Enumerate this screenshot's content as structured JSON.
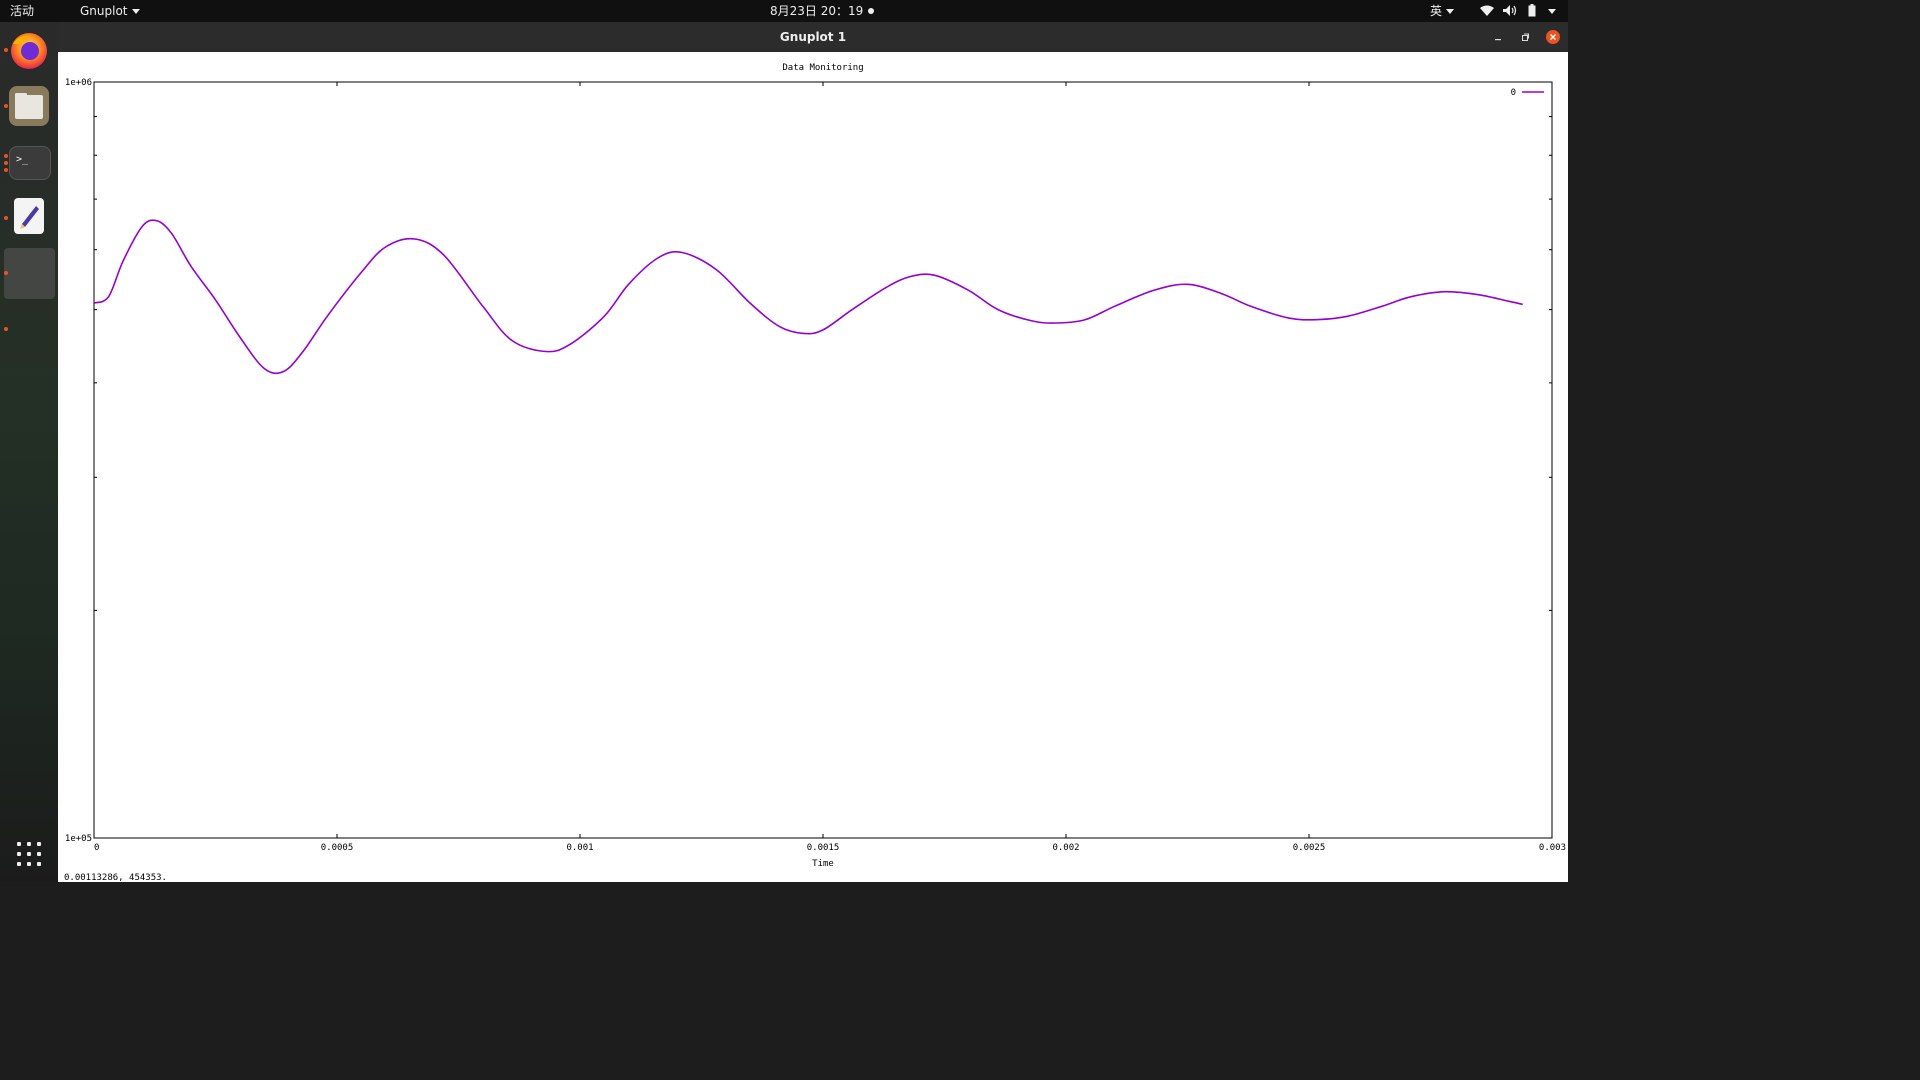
{
  "topbar": {
    "activities": "活动",
    "app_menu": "Gnuplot",
    "clock": "8月23日  20：19",
    "ime": "英"
  },
  "dock": {
    "apps": [
      {
        "name": "firefox-icon",
        "running": true
      },
      {
        "name": "files-icon",
        "running": true
      },
      {
        "name": "terminal-icon",
        "running": true
      },
      {
        "name": "text-editor-icon",
        "running": true
      },
      {
        "name": "gnuplot-window-icon",
        "running": true
      }
    ]
  },
  "window": {
    "title": "Gnuplot 1"
  },
  "chart_data": {
    "type": "line",
    "title": "Data Monitoring",
    "xlabel": "Time",
    "ylabel": "",
    "xscale": "linear",
    "yscale": "log",
    "xlim": [
      0,
      0.003
    ],
    "ylim": [
      100000,
      1000000
    ],
    "x_ticks": [
      "0",
      "0.0005",
      "0.001",
      "0.0015",
      "0.002",
      "0.0025",
      "0.003"
    ],
    "y_tick_labels": [
      "1e+06",
      "1e+05"
    ],
    "legend": {
      "position": "top-right",
      "entries": [
        "0"
      ]
    },
    "series": [
      {
        "name": "0",
        "color": "#9400d3",
        "x": [
          0,
          3e-05,
          6e-05,
          0.0001,
          0.00013,
          0.00016,
          0.0002,
          0.00025,
          0.0003,
          0.00035,
          0.00039,
          0.00043,
          0.00048,
          0.00055,
          0.0006,
          0.00066,
          0.00072,
          0.0008,
          0.00086,
          0.00093,
          0.00098,
          0.00105,
          0.0011,
          0.00116,
          0.00121,
          0.00128,
          0.00135,
          0.00141,
          0.00146,
          0.0015,
          0.00156,
          0.00163,
          0.00168,
          0.00173,
          0.0018,
          0.00186,
          0.00193,
          0.00198,
          0.00204,
          0.0021,
          0.00218,
          0.00225,
          0.00232,
          0.00238,
          0.00246,
          0.00252,
          0.00258,
          0.00265,
          0.00271,
          0.00278,
          0.00285,
          0.00291,
          0.00294
        ],
        "y": [
          510000,
          520000,
          580000,
          645000,
          655000,
          630000,
          570000,
          515000,
          460000,
          418000,
          414000,
          440000,
          490000,
          560000,
          605000,
          620000,
          590000,
          505000,
          455000,
          440000,
          450000,
          490000,
          540000,
          585000,
          595000,
          565000,
          510000,
          475000,
          465000,
          470000,
          500000,
          535000,
          553000,
          555000,
          530000,
          500000,
          483000,
          480000,
          485000,
          505000,
          530000,
          540000,
          525000,
          505000,
          487000,
          485000,
          490000,
          505000,
          520000,
          528000,
          523000,
          513000,
          508000
        ]
      }
    ]
  },
  "status": {
    "mouse_coords": "0.00113286,  454353."
  }
}
